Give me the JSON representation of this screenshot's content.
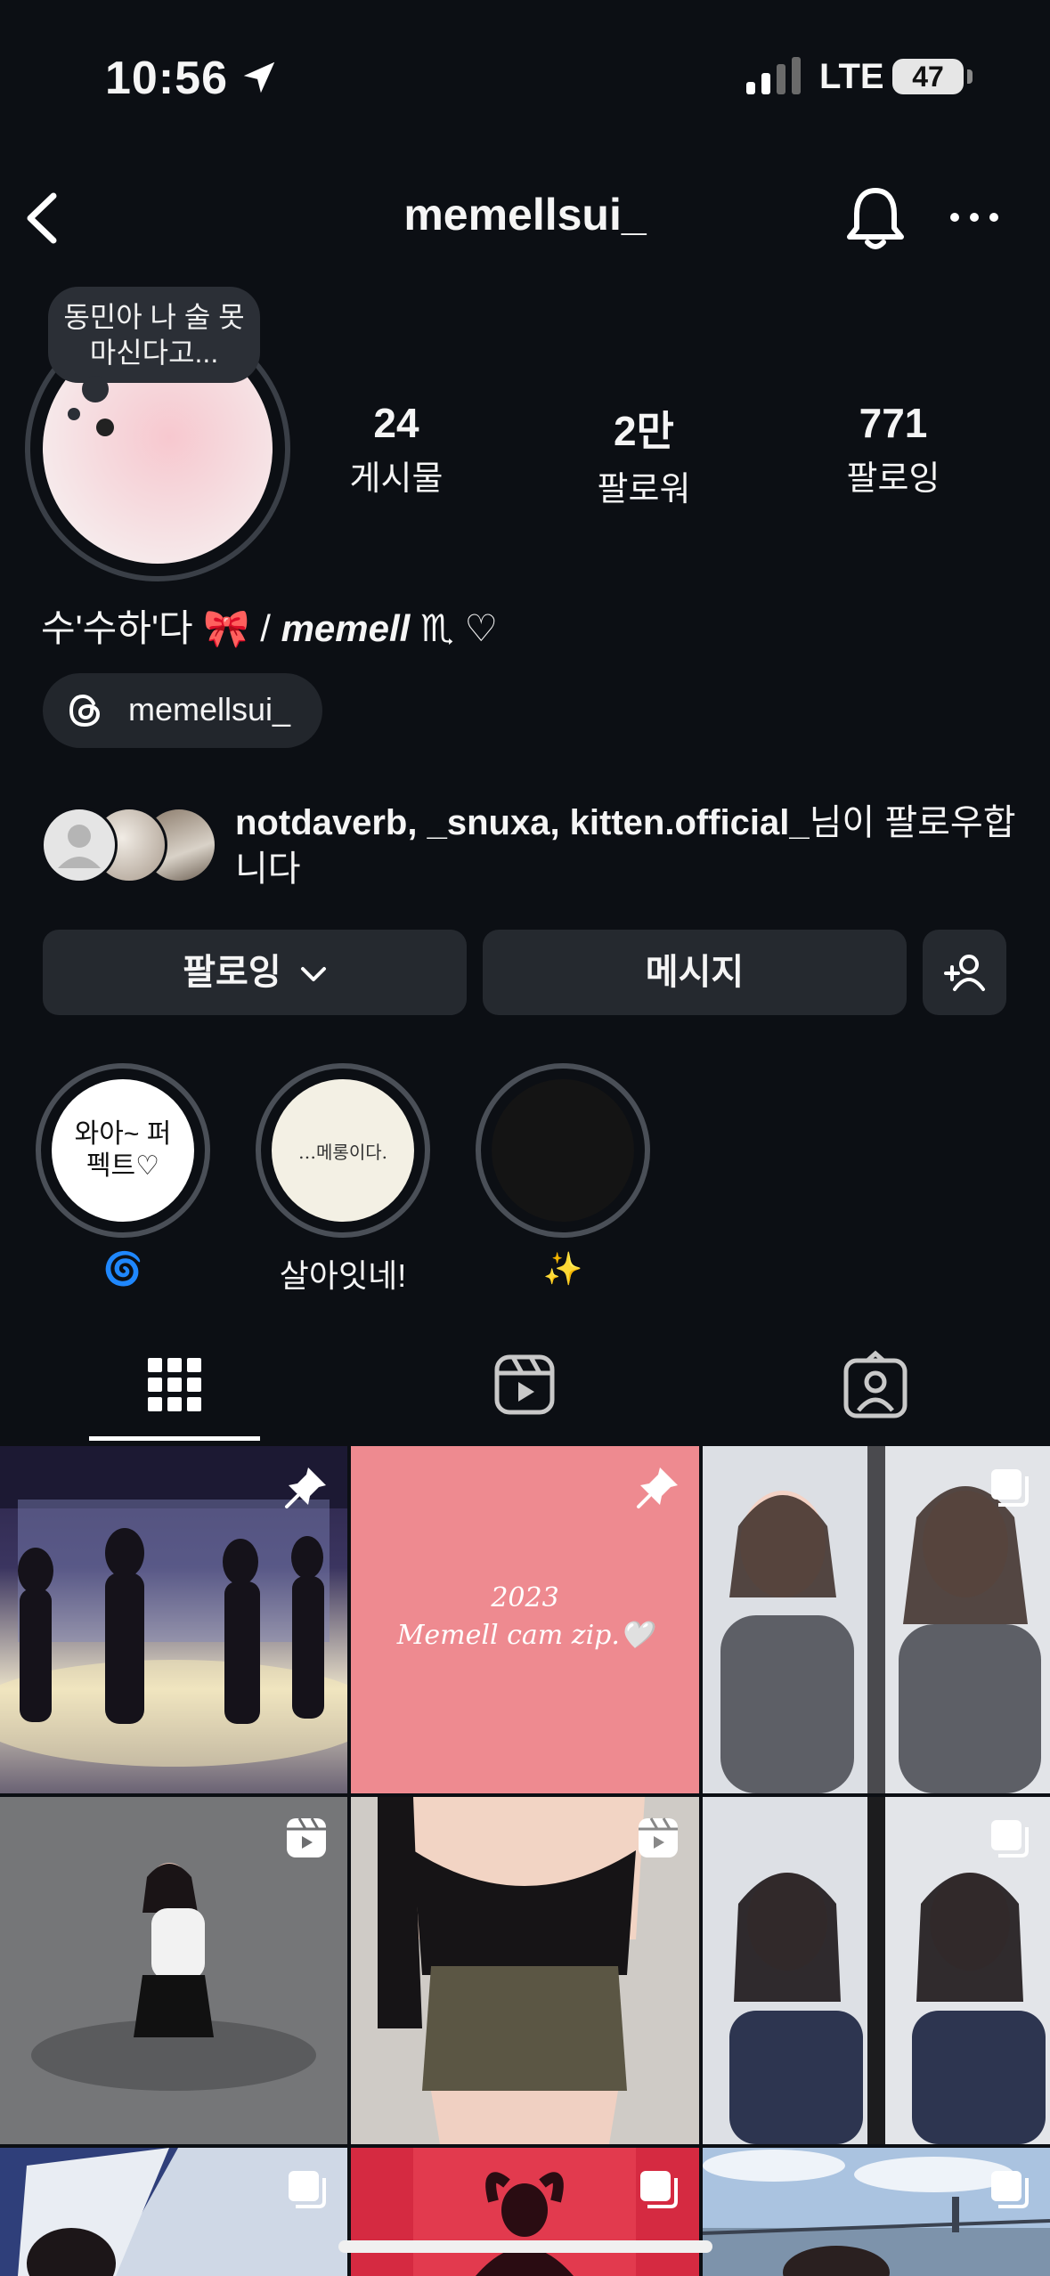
{
  "status_bar": {
    "time": "10:56",
    "network": "LTE",
    "battery": "47"
  },
  "nav": {
    "username": "memellsui_"
  },
  "profile": {
    "note": "동민아 나 술 못 마신다고...",
    "stats": [
      {
        "value": "24",
        "label": "게시물"
      },
      {
        "value": "2만",
        "label": "팔로워"
      },
      {
        "value": "771",
        "label": "팔로잉"
      }
    ],
    "bio_name": "수'수하'다 🎀 /",
    "bio_handle": "memell",
    "bio_tail": "♏︎ ♡",
    "threads_handle": "memellsui_",
    "mutual_names": "notdaverb, _snuxa, kitten.official_",
    "mutual_suffix": "님이 팔로우합니다"
  },
  "actions": {
    "following_label": "팔로잉",
    "message_label": "메시지"
  },
  "highlights": [
    {
      "cover_text": "와아~ 퍼펙트♡",
      "label": "🌀"
    },
    {
      "cover_text": "…메롱이다.",
      "label": "살아잇네!"
    },
    {
      "cover_text": "",
      "label": "✨"
    }
  ],
  "posts": [
    {
      "overlay": "pin",
      "caption": ""
    },
    {
      "overlay": "pin",
      "caption": "2023\nMemell cam zip.🤍"
    },
    {
      "overlay": "carousel",
      "caption": ""
    },
    {
      "overlay": "reel",
      "caption": ""
    },
    {
      "overlay": "reel",
      "caption": ""
    },
    {
      "overlay": "carousel",
      "caption": ""
    },
    {
      "overlay": "carousel",
      "caption": ""
    },
    {
      "overlay": "carousel",
      "caption": ""
    },
    {
      "overlay": "carousel",
      "caption": ""
    }
  ],
  "colors": {
    "background": "#0c0f14",
    "button": "#25292f",
    "accent_pink": "#ee8a90"
  }
}
